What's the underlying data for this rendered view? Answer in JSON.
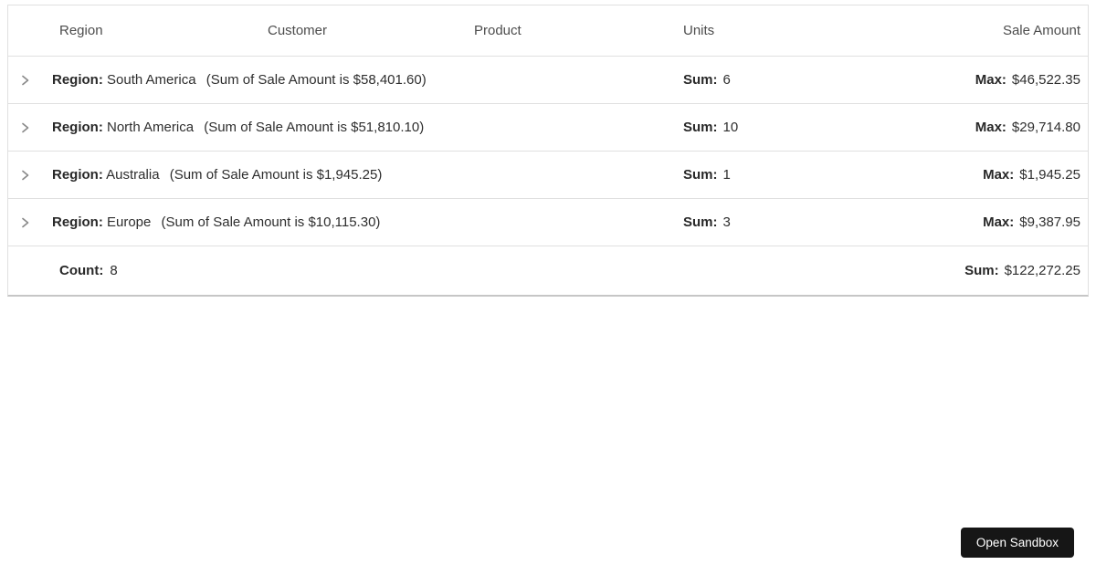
{
  "data_grid": {
    "columns": [
      {
        "label": "Region"
      },
      {
        "label": "Customer"
      },
      {
        "label": "Product"
      },
      {
        "label": "Units"
      },
      {
        "label": "Sale Amount"
      }
    ],
    "group_rows": [
      {
        "label": "Region:",
        "value": "South America",
        "summary": "(Sum of Sale Amount is $58,401.60)",
        "units_label": "Sum:",
        "units_value": "6",
        "sale_label": "Max:",
        "sale_value": "$46,522.35"
      },
      {
        "label": "Region:",
        "value": "North America",
        "summary": "(Sum of Sale Amount is $51,810.10)",
        "units_label": "Sum:",
        "units_value": "10",
        "sale_label": "Max:",
        "sale_value": "$29,714.80"
      },
      {
        "label": "Region:",
        "value": "Australia",
        "summary": "(Sum of Sale Amount is $1,945.25)",
        "units_label": "Sum:",
        "units_value": "1",
        "sale_label": "Max:",
        "sale_value": "$1,945.25"
      },
      {
        "label": "Region:",
        "value": "Europe",
        "summary": "(Sum of Sale Amount is $10,115.30)",
        "units_label": "Sum:",
        "units_value": "3",
        "sale_label": "Max:",
        "sale_value": "$9,387.95"
      }
    ],
    "footer": {
      "count_label": "Count:",
      "count_value": "8",
      "sum_label": "Sum:",
      "sum_value": "$122,272.25"
    }
  },
  "toolbar": {
    "open_sandbox_label": "Open Sandbox"
  },
  "colors": {
    "button_bg": "#161616",
    "button_text": "#ffffff",
    "row_border": "#e0e0e0",
    "outer_border_bottom": "#c6c6c6",
    "header_text": "#4c4c4c",
    "body_text": "#2e2e2e",
    "chevron": "#8a8a8a"
  }
}
